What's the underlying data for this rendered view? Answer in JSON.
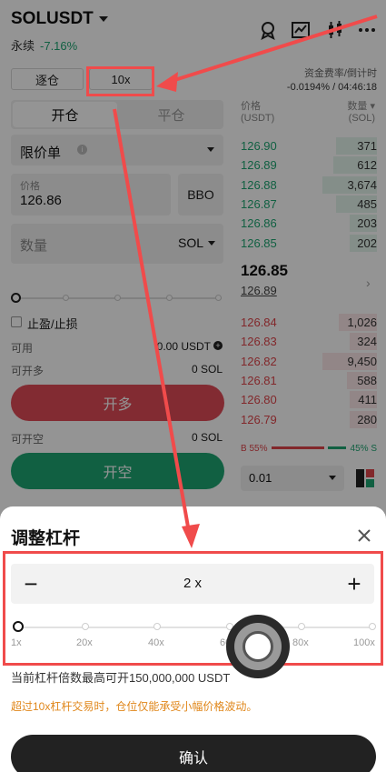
{
  "header": {
    "pair": "SOLUSDT",
    "market_type": "永续",
    "change": "-7.16%"
  },
  "margin_mode": "逐仓",
  "leverage_button": "10x",
  "funding": {
    "label": "资金费率/倒计时",
    "value": "-0.0194% / 04:46:18"
  },
  "order_tabs": [
    "开仓",
    "平仓"
  ],
  "order_type": "限价单",
  "price_field": {
    "label": "价格",
    "value": "126.86"
  },
  "bbo_label": "BBO",
  "quantity_field": {
    "placeholder": "数量",
    "unit": "SOL"
  },
  "tpsl_label": "止盈/止损",
  "available": {
    "label": "可用",
    "value": "0.00 USDT"
  },
  "can_open_long": {
    "label": "可开多",
    "value": "0 SOL"
  },
  "buy_button": "开多",
  "can_open_short": {
    "label": "可开空",
    "value": "0 SOL"
  },
  "sell_button": "开空",
  "orderbook": {
    "price_header": [
      "价格",
      "(USDT)"
    ],
    "qty_header": [
      "数量",
      "(SOL)"
    ],
    "bids": [
      {
        "price": "126.90",
        "qty": "371",
        "depth": 0.3
      },
      {
        "price": "126.89",
        "qty": "612",
        "depth": 0.32
      },
      {
        "price": "126.88",
        "qty": "3,674",
        "depth": 0.4
      },
      {
        "price": "126.87",
        "qty": "485",
        "depth": 0.3
      },
      {
        "price": "126.86",
        "qty": "203",
        "depth": 0.2
      },
      {
        "price": "126.85",
        "qty": "202",
        "depth": 0.2
      }
    ],
    "last_price": "126.85",
    "mark_price": "126.89",
    "asks": [
      {
        "price": "126.84",
        "qty": "1,026",
        "depth": 0.28
      },
      {
        "price": "126.83",
        "qty": "324",
        "depth": 0.2
      },
      {
        "price": "126.82",
        "qty": "9,450",
        "depth": 0.4
      },
      {
        "price": "126.81",
        "qty": "588",
        "depth": 0.22
      },
      {
        "price": "126.80",
        "qty": "411",
        "depth": 0.2
      },
      {
        "price": "126.79",
        "qty": "280",
        "depth": 0.2
      }
    ],
    "buy_ratio": "B 55%",
    "sell_ratio": "45% S",
    "precision": "0.01"
  },
  "modal": {
    "title": "调整杠杆",
    "value": "2 x",
    "scale": [
      "1x",
      "20x",
      "40x",
      "60x",
      "80x",
      "100x"
    ],
    "max_info": "当前杠杆倍数最高可开150,000,000 USDT",
    "warning": "超过10x杠杆交易时，仓位仅能承受小幅价格波动。",
    "confirm": "确认"
  },
  "colors": {
    "buy": "#e04a57",
    "sell": "#1ea672",
    "warning": "#e0871b",
    "annotation": "#f04b4b"
  }
}
